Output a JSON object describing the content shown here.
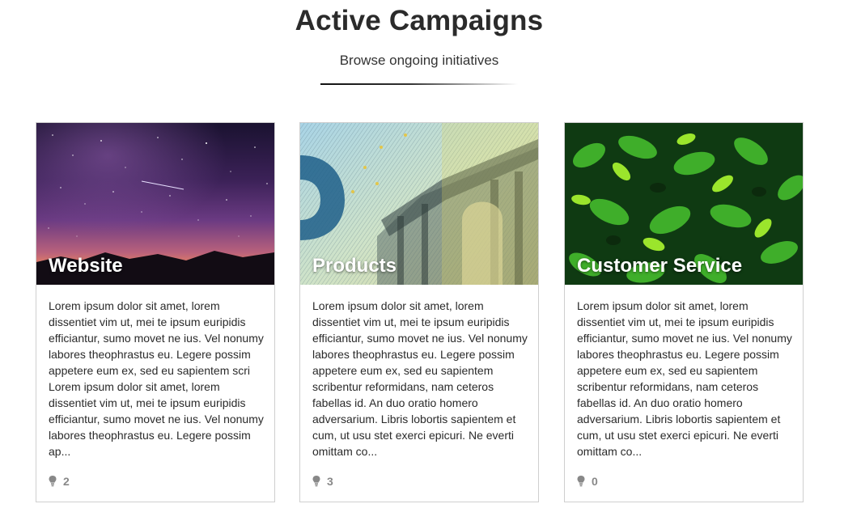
{
  "header": {
    "title": "Active Campaigns",
    "subtitle": "Browse ongoing initiatives"
  },
  "cards": [
    {
      "title": "Website",
      "description": "Lorem ipsum dolor sit amet, lorem dissentiet vim ut, mei te ipsum euripidis efficiantur, sumo movet ne ius. Vel nonumy labores theophrastus eu. Legere possim appetere eum ex, sed eu sapientem scri Lorem ipsum dolor sit amet, lorem dissentiet vim ut, mei te ipsum euripidis efficiantur, sumo movet ne ius. Vel nonumy labores theophrastus eu. Legere possim ap...",
      "count": "2",
      "image": "night-sky-image",
      "icon": "lightbulb-icon"
    },
    {
      "title": "Products",
      "description": "Lorem ipsum dolor sit amet, lorem dissentiet vim ut, mei te ipsum euripidis efficiantur, sumo movet ne ius. Vel nonumy labores theophrastus eu. Legere possim appetere eum ex, sed eu sapientem scribentur reformidans, nam ceteros fabellas id. An duo oratio homero adversarium. Libris lobortis sapientem et cum, ut usu stet exerci epicuri. Ne everti omittam co...",
      "count": "3",
      "image": "banknote-image",
      "icon": "lightbulb-icon"
    },
    {
      "title": "Customer Service",
      "description": "Lorem ipsum dolor sit amet, lorem dissentiet vim ut, mei te ipsum euripidis efficiantur, sumo movet ne ius. Vel nonumy labores theophrastus eu. Legere possim appetere eum ex, sed eu sapientem scribentur reformidans, nam ceteros fabellas id. An duo oratio homero adversarium. Libris lobortis sapientem et cum, ut usu stet exerci epicuri. Ne everti omittam co...",
      "count": "0",
      "image": "green-plants-image",
      "icon": "lightbulb-icon"
    }
  ],
  "colors": {
    "title_text": "#2b2b2b",
    "card_border": "#cfcfcf",
    "footer_icon": "#888888"
  }
}
